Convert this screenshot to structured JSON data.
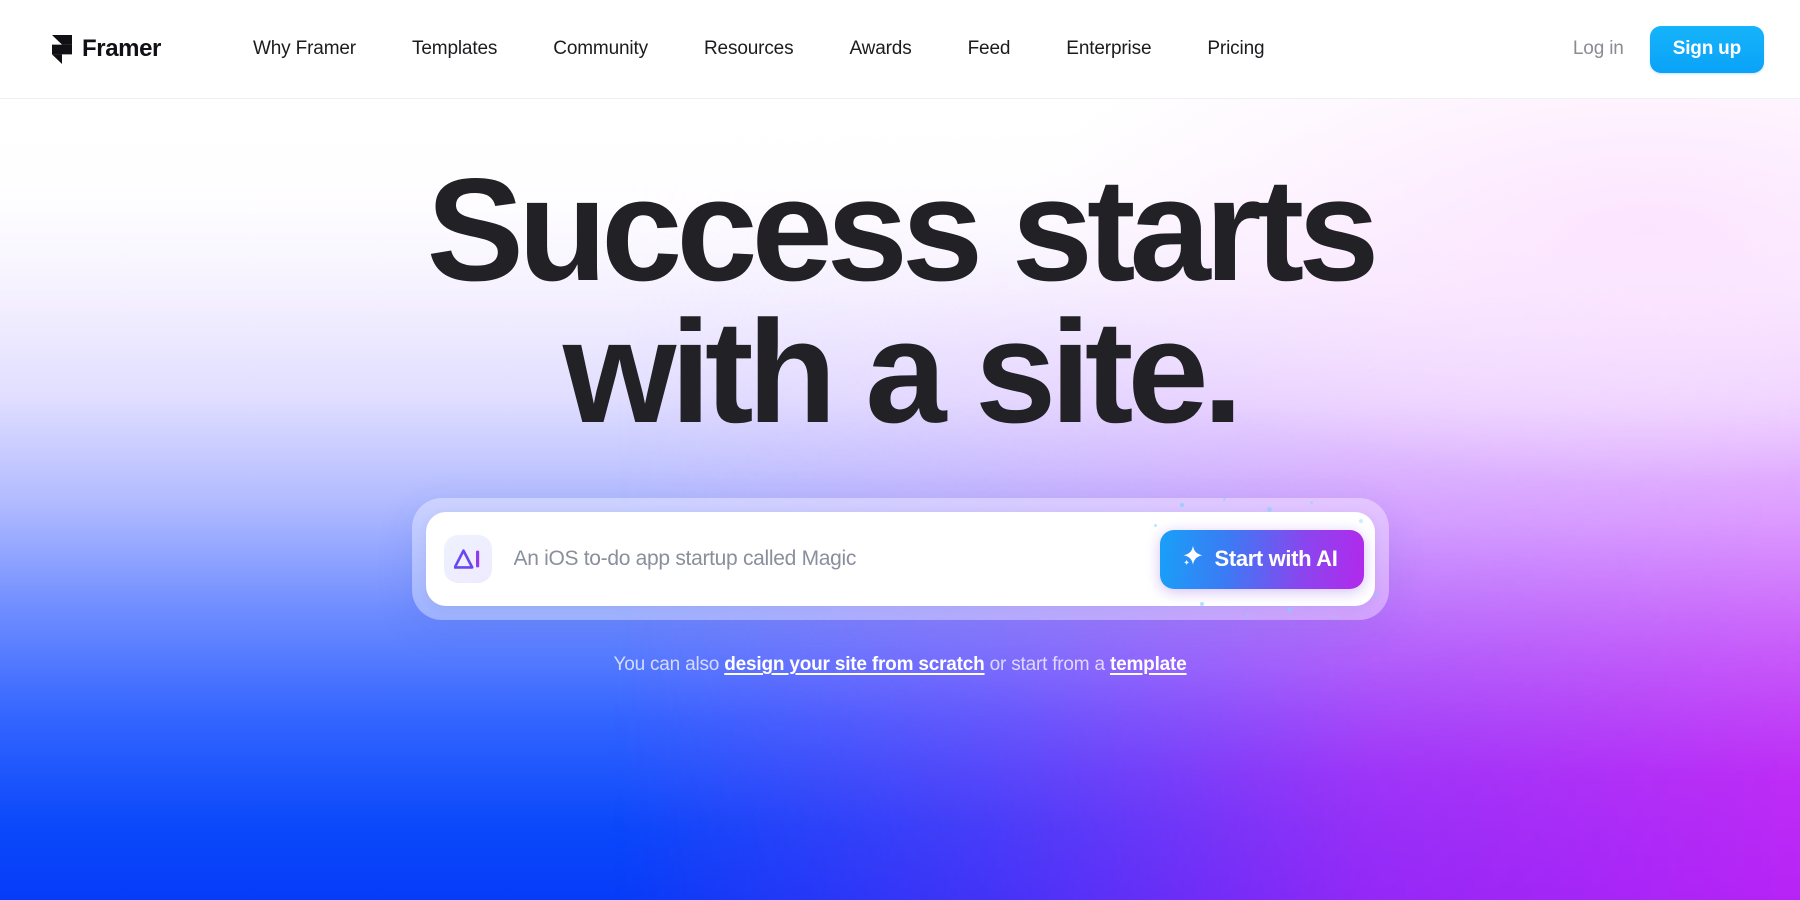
{
  "header": {
    "brand": {
      "name": "Framer",
      "logo_icon": "framer-logo-icon"
    },
    "nav_items": [
      {
        "label": "Why Framer"
      },
      {
        "label": "Templates"
      },
      {
        "label": "Community"
      },
      {
        "label": "Resources"
      },
      {
        "label": "Awards"
      },
      {
        "label": "Feed"
      },
      {
        "label": "Enterprise"
      },
      {
        "label": "Pricing"
      }
    ],
    "login_label": "Log in",
    "signup_label": "Sign up",
    "signup_color": "#0aa2f7"
  },
  "hero": {
    "headline_line1": "Success starts",
    "headline_line2": "with a site.",
    "headline_color": "#222226"
  },
  "prompt": {
    "badge_icon": "ai-wordmark-icon",
    "badge_text": "AI",
    "placeholder": "An iOS to-do app startup called Magic",
    "value": "",
    "cta_label": "Start with AI",
    "cta_icon": "sparkle-star-icon",
    "cta_gradient_from": "#18a0f8",
    "cta_gradient_to": "#b229ec"
  },
  "subline": {
    "prefix": "You can also ",
    "link1": "design your site from scratch",
    "middle": " or start from a ",
    "link2": "template"
  },
  "background": {
    "blue": "#063cf8",
    "purple": "#b723f6",
    "top": "#ffffff"
  }
}
